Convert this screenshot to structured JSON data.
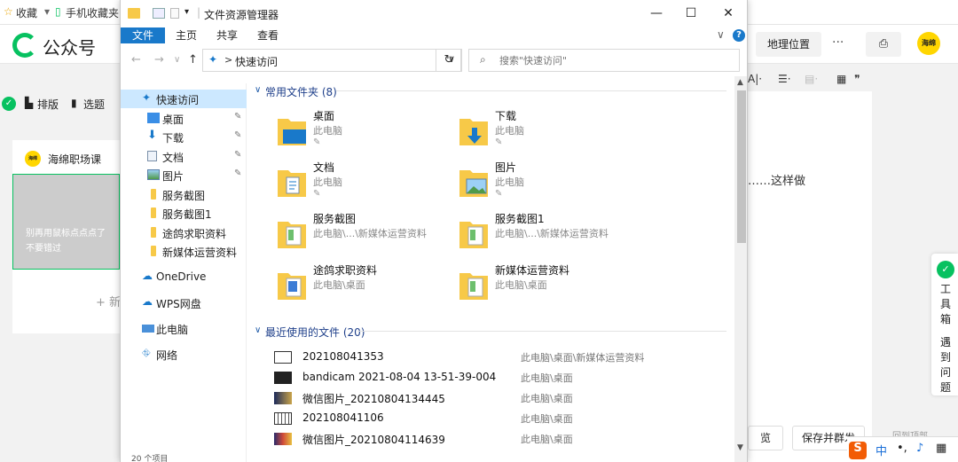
{
  "background_app": {
    "favorites": [
      "收藏",
      "手机收藏夹"
    ],
    "brand": "公众号",
    "header_buttons": [
      "地理位置",
      "···"
    ],
    "avatar_text": "海绵",
    "toolbar_items": [
      "排版",
      "选题"
    ],
    "account_name": "海绵职场课",
    "cover_text_line1": "别再用鼠标点点点了",
    "cover_text_line2": "不要错过",
    "add_label": "+ 新",
    "content_text": "……这样做",
    "toolbox_label": "工具箱",
    "feedback_label": "遇到问题",
    "preview_label": "览",
    "save_label": "保存并群发",
    "back_top": "回到顶部",
    "ime_label": "中"
  },
  "explorer": {
    "title": "文件资源管理器",
    "controls": {
      "minimize": "—",
      "maximize": "☐",
      "close": "✕"
    },
    "ribbon_tabs": [
      "文件",
      "主页",
      "共享",
      "查看"
    ],
    "address": {
      "path": "快速访问",
      "separator": ">"
    },
    "search_placeholder": "搜索\"快速访问\"",
    "nav": {
      "quick_access": "快速访问",
      "pinned": [
        {
          "label": "桌面",
          "icon": "desktop-icon"
        },
        {
          "label": "下载",
          "icon": "download-icon"
        },
        {
          "label": "文档",
          "icon": "document-icon"
        },
        {
          "label": "图片",
          "icon": "pictures-icon"
        }
      ],
      "folders": [
        "服务截图",
        "服务截图1",
        "途鸽求职资料",
        "新媒体运营资料"
      ],
      "roots": [
        {
          "label": "OneDrive",
          "icon": "cloud-icon"
        },
        {
          "label": "WPS网盘",
          "icon": "cloud-icon"
        },
        {
          "label": "此电脑",
          "icon": "computer-icon"
        },
        {
          "label": "网络",
          "icon": "network-icon"
        }
      ]
    },
    "frequent": {
      "title": "常用文件夹 (8)",
      "items": [
        {
          "name": "桌面",
          "location": "此电脑",
          "pinned": true
        },
        {
          "name": "下载",
          "location": "此电脑",
          "pinned": true
        },
        {
          "name": "文档",
          "location": "此电脑",
          "pinned": true
        },
        {
          "name": "图片",
          "location": "此电脑",
          "pinned": true
        },
        {
          "name": "服务截图",
          "location": "此电脑\\...\\新媒体运营资料",
          "pinned": false
        },
        {
          "name": "服务截图1",
          "location": "此电脑\\...\\新媒体运营资料",
          "pinned": false
        },
        {
          "name": "途鸽求职资料",
          "location": "此电脑\\桌面",
          "pinned": false
        },
        {
          "name": "新媒体运营资料",
          "location": "此电脑\\桌面",
          "pinned": false
        }
      ]
    },
    "recent": {
      "title": "最近使用的文件 (20)",
      "items": [
        {
          "name": "202108041353",
          "path": "此电脑\\桌面\\新媒体运营资料"
        },
        {
          "name": "bandicam 2021-08-04 13-51-39-004",
          "path": "此电脑\\桌面"
        },
        {
          "name": "微信图片_20210804134445",
          "path": "此电脑\\桌面"
        },
        {
          "name": "202108041106",
          "path": "此电脑\\桌面"
        },
        {
          "name": "微信图片_20210804114639",
          "path": "此电脑\\桌面"
        }
      ]
    },
    "status": "20 个项目"
  }
}
